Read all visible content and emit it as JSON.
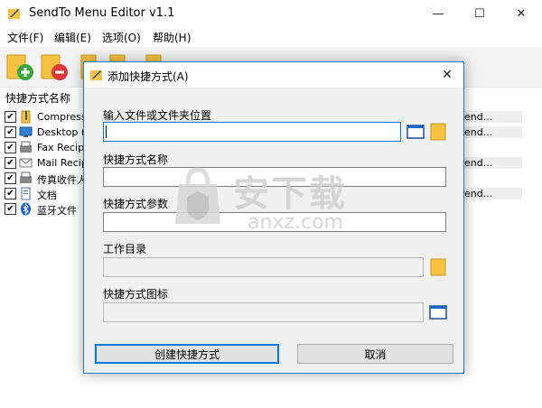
{
  "window": {
    "title": "SendTo Menu Editor v1.1",
    "min_glyph": "—",
    "max_glyph": "☐",
    "close_glyph": "✕"
  },
  "menu": [
    "文件(F)",
    "编辑(E)",
    "选项(O)",
    "帮助(H)"
  ],
  "list": {
    "header": "快捷方式名称",
    "rows": [
      {
        "label": "Compresse",
        "target": "end...",
        "icon": "zip-folder-icon"
      },
      {
        "label": "Desktop (c",
        "target": "end...",
        "icon": "desktop-icon"
      },
      {
        "label": "Fax Recipi",
        "target": "",
        "icon": "fax-icon"
      },
      {
        "label": "Mail Recipi",
        "target": "end...",
        "icon": "mail-icon"
      },
      {
        "label": "传真收件人",
        "target": "",
        "icon": "fax-icon"
      },
      {
        "label": "文档",
        "target": "end...",
        "icon": "document-icon"
      },
      {
        "label": "蓝牙文件",
        "target": "",
        "icon": "bluetooth-icon"
      }
    ]
  },
  "dialog": {
    "title": "添加快捷方式(A)",
    "close_glyph": "✕",
    "fields": {
      "location_label": "输入文件或文件夹位置",
      "location_value": "",
      "name_label": "快捷方式名称",
      "name_value": "",
      "args_label": "快捷方式参数",
      "args_value": "",
      "workdir_label": "工作目录",
      "workdir_value": "",
      "icon_label": "快捷方式图标",
      "icon_value": ""
    },
    "create_button": "创建快捷方式",
    "cancel_button": "取消"
  },
  "watermark": {
    "cn": "安下载",
    "url": "anxz.com"
  },
  "colors": {
    "accent": "#0078d7",
    "folder": "#f5c242",
    "add_green": "#3aa63a",
    "remove_red": "#d93a3a"
  }
}
